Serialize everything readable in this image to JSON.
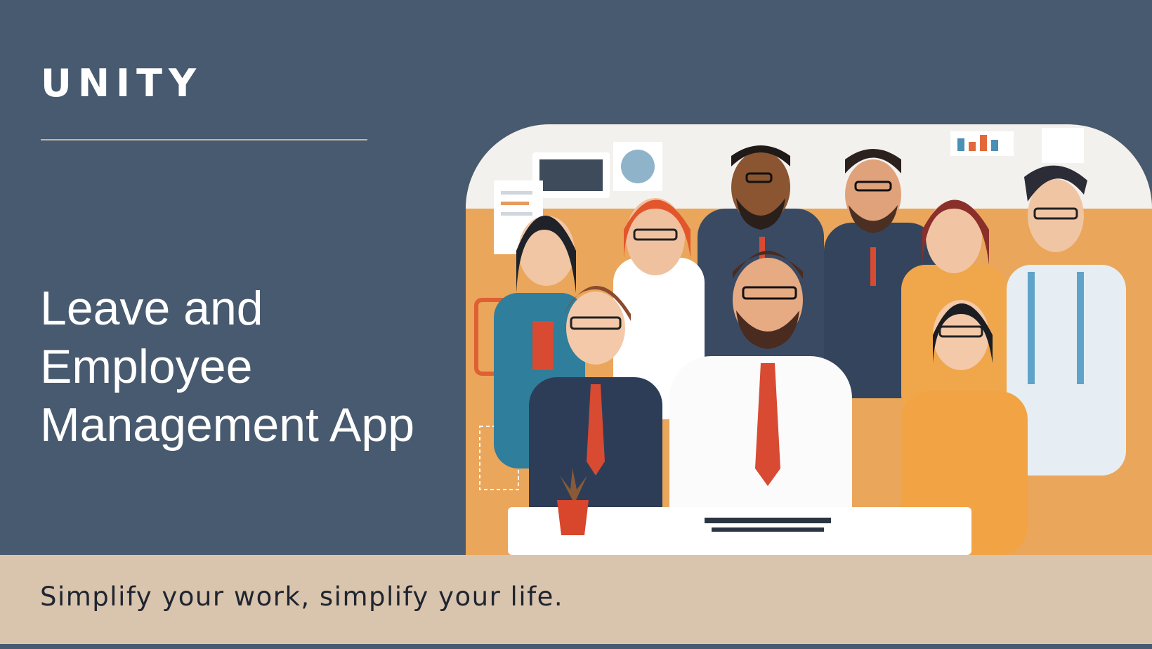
{
  "brand": {
    "name": "UNITY"
  },
  "hero": {
    "headline_lines": [
      "Leave and",
      "Employee",
      "Management App"
    ]
  },
  "footer": {
    "tagline": "Simplify your work, simplify your life."
  },
  "colors": {
    "background": "#475a6f",
    "band": "#d9c4ad",
    "divider": "#c9b6a2",
    "text_light": "#ffffff",
    "text_dark": "#1f2530"
  },
  "image": {
    "icon": "team-thumbs-up-illustration"
  }
}
